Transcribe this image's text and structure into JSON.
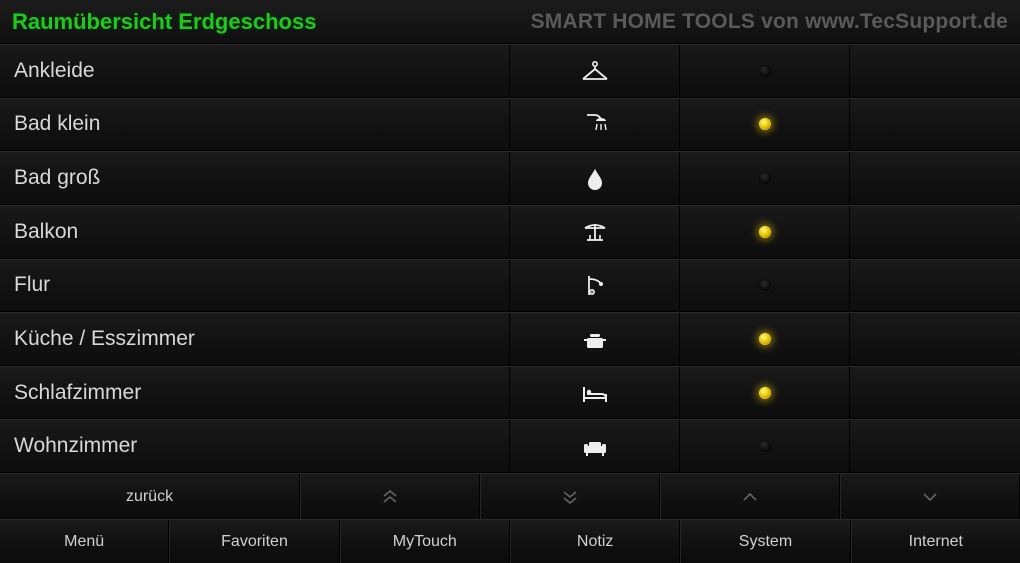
{
  "header": {
    "title": "Raumübersicht Erdgeschoss",
    "brand": "SMART HOME TOOLS von www.TecSupport.de"
  },
  "rooms": [
    {
      "name": "Ankleide",
      "icon": "hanger",
      "led_on": false
    },
    {
      "name": "Bad klein",
      "icon": "shower",
      "led_on": true
    },
    {
      "name": "Bad groß",
      "icon": "drop",
      "led_on": false
    },
    {
      "name": "Balkon",
      "icon": "terrace",
      "led_on": true
    },
    {
      "name": "Flur",
      "icon": "door",
      "led_on": false
    },
    {
      "name": "Küche / Esszimmer",
      "icon": "pot",
      "led_on": true
    },
    {
      "name": "Schlafzimmer",
      "icon": "bed",
      "led_on": true
    },
    {
      "name": "Wohnzimmer",
      "icon": "sofa",
      "led_on": false
    }
  ],
  "navbar": {
    "back_label": "zurück"
  },
  "menubar": {
    "items": [
      "Menü",
      "Favoriten",
      "MyTouch",
      "Notiz",
      "System",
      "Internet"
    ]
  },
  "colors": {
    "title_green": "#1ec81e",
    "led_on": "#f0d000",
    "led_off": "#1a1a1a"
  }
}
